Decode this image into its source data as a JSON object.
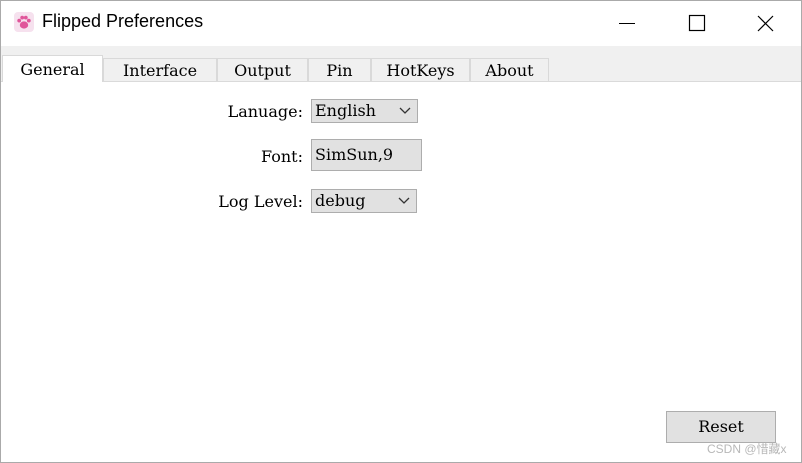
{
  "window": {
    "title": "Flipped Preferences",
    "icon": "paw-icon",
    "controls": [
      "minimize-icon",
      "maximize-icon",
      "close-icon"
    ]
  },
  "tabs": [
    {
      "label": "General",
      "active": true
    },
    {
      "label": "Interface",
      "active": false
    },
    {
      "label": "Output",
      "active": false
    },
    {
      "label": "Pin",
      "active": false
    },
    {
      "label": "HotKeys",
      "active": false
    },
    {
      "label": "About",
      "active": false
    }
  ],
  "general": {
    "language_label": "Lanuage:",
    "language_value": "English",
    "font_label": "Font:",
    "font_value": "SimSun,9",
    "log_level_label": "Log Level:",
    "log_level_value": "debug"
  },
  "reset_label": "Reset",
  "watermark": "CSDN @惜藏x",
  "colors": {
    "tab_bar_bg": "#f0f0f0",
    "button_bg": "#e1e1e1",
    "button_border": "#adadad",
    "icon_pink": "#e0559a"
  }
}
